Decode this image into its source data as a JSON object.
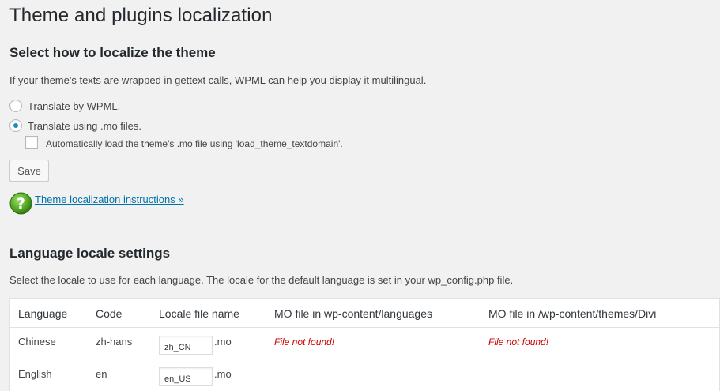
{
  "page": {
    "title": "Theme and plugins localization"
  },
  "theme_section": {
    "heading": "Select how to localize the theme",
    "description": "If your theme's texts are wrapped in gettext calls, WPML can help you display it multilingual.",
    "options": [
      {
        "label": "Translate by WPML.",
        "checked": false
      },
      {
        "label": "Translate using .mo files.",
        "checked": true
      }
    ],
    "auto_load_label": "Automatically load the theme's .mo file using 'load_theme_textdomain'.",
    "auto_load_checked": false,
    "save_label": "Save",
    "help_link": "Theme localization instructions »",
    "help_icon": "question-mark-icon"
  },
  "locale_section": {
    "heading": "Language locale settings",
    "description": "Select the locale to use for each language. The locale for the default language is set in your wp_config.php file.",
    "columns": [
      "Language",
      "Code",
      "Locale file name",
      "MO file in wp-content/languages",
      "MO file in /wp-content/themes/Divi"
    ],
    "rows": [
      {
        "language": "Chinese",
        "code": "zh-hans",
        "locale": "zh_CN",
        "suffix": ".mo",
        "mo_languages": "File not found!",
        "mo_theme": "File not found!"
      },
      {
        "language": "English",
        "code": "en",
        "locale": "en_US",
        "suffix": ".mo",
        "mo_languages": "",
        "mo_theme": ""
      }
    ]
  },
  "colors": {
    "background": "#f1f1f1",
    "link": "#0073aa",
    "error": "#cc0000",
    "radio_checked": "#1e8cbe",
    "help_icon_green": "#5aab2a"
  }
}
